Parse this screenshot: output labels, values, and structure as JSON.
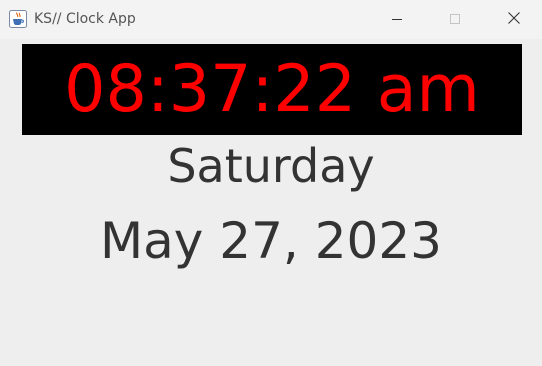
{
  "window": {
    "title": "KS// Clock App",
    "icons": {
      "app": "java-cup-icon",
      "minimize": "minimize-icon",
      "maximize": "maximize-icon",
      "close": "close-icon"
    }
  },
  "clock": {
    "time": "08:37:22 am",
    "day": "Saturday",
    "date": "May 27, 2023"
  },
  "colors": {
    "time_text": "#ff0000",
    "time_background": "#000000",
    "label_text": "#333333",
    "window_background": "#eeeeee"
  }
}
